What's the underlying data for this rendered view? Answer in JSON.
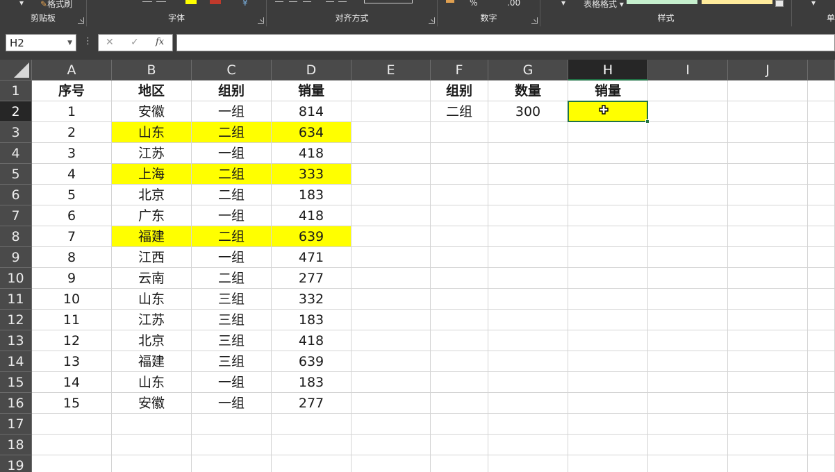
{
  "ribbon": {
    "groups": [
      {
        "label": "剪贴板"
      },
      {
        "label": "字体"
      },
      {
        "label": "对齐方式"
      },
      {
        "label": "数字"
      },
      {
        "label": "样式"
      },
      {
        "label": "单"
      }
    ],
    "format_painter": "格式刷",
    "table_format": "表格格式"
  },
  "formula_bar": {
    "name_box": "H2",
    "cancel_glyph": "✕",
    "enter_glyph": "✓",
    "fx_glyph": "fx",
    "formula": ""
  },
  "sheet": {
    "columns": [
      "A",
      "B",
      "C",
      "D",
      "E",
      "F",
      "G",
      "H",
      "I",
      "J"
    ],
    "selected_column": "H",
    "selected_row": 2,
    "row_numbers": [
      1,
      2,
      3,
      4,
      5,
      6,
      7,
      8,
      9,
      10,
      11,
      12,
      13,
      14,
      15,
      16,
      17,
      18,
      19
    ],
    "table": {
      "headers": [
        "序号",
        "地区",
        "组别",
        "销量"
      ],
      "rows": [
        {
          "no": "1",
          "region": "安徽",
          "group": "一组",
          "sales": "814",
          "highlight": false
        },
        {
          "no": "2",
          "region": "山东",
          "group": "二组",
          "sales": "634",
          "highlight": true
        },
        {
          "no": "3",
          "region": "江苏",
          "group": "一组",
          "sales": "418",
          "highlight": false
        },
        {
          "no": "4",
          "region": "上海",
          "group": "二组",
          "sales": "333",
          "highlight": true
        },
        {
          "no": "5",
          "region": "北京",
          "group": "二组",
          "sales": "183",
          "highlight": false
        },
        {
          "no": "6",
          "region": "广东",
          "group": "一组",
          "sales": "418",
          "highlight": false
        },
        {
          "no": "7",
          "region": "福建",
          "group": "二组",
          "sales": "639",
          "highlight": true
        },
        {
          "no": "8",
          "region": "江西",
          "group": "一组",
          "sales": "471",
          "highlight": false
        },
        {
          "no": "9",
          "region": "云南",
          "group": "二组",
          "sales": "277",
          "highlight": false
        },
        {
          "no": "10",
          "region": "山东",
          "group": "三组",
          "sales": "332",
          "highlight": false
        },
        {
          "no": "11",
          "region": "江苏",
          "group": "三组",
          "sales": "183",
          "highlight": false
        },
        {
          "no": "12",
          "region": "北京",
          "group": "三组",
          "sales": "418",
          "highlight": false
        },
        {
          "no": "13",
          "region": "福建",
          "group": "三组",
          "sales": "639",
          "highlight": false
        },
        {
          "no": "14",
          "region": "山东",
          "group": "一组",
          "sales": "183",
          "highlight": false
        },
        {
          "no": "15",
          "region": "安徽",
          "group": "一组",
          "sales": "277",
          "highlight": false
        }
      ]
    },
    "summary": {
      "headers": [
        "组别",
        "数量",
        "销量"
      ],
      "group": "二组",
      "count": "300",
      "sales": ""
    }
  },
  "colors": {
    "highlight": "#ffff00",
    "selection": "#217346",
    "header_bg": "#4a4a4a",
    "header_selected_bg": "#262626",
    "gridline": "#d4d4d4"
  }
}
